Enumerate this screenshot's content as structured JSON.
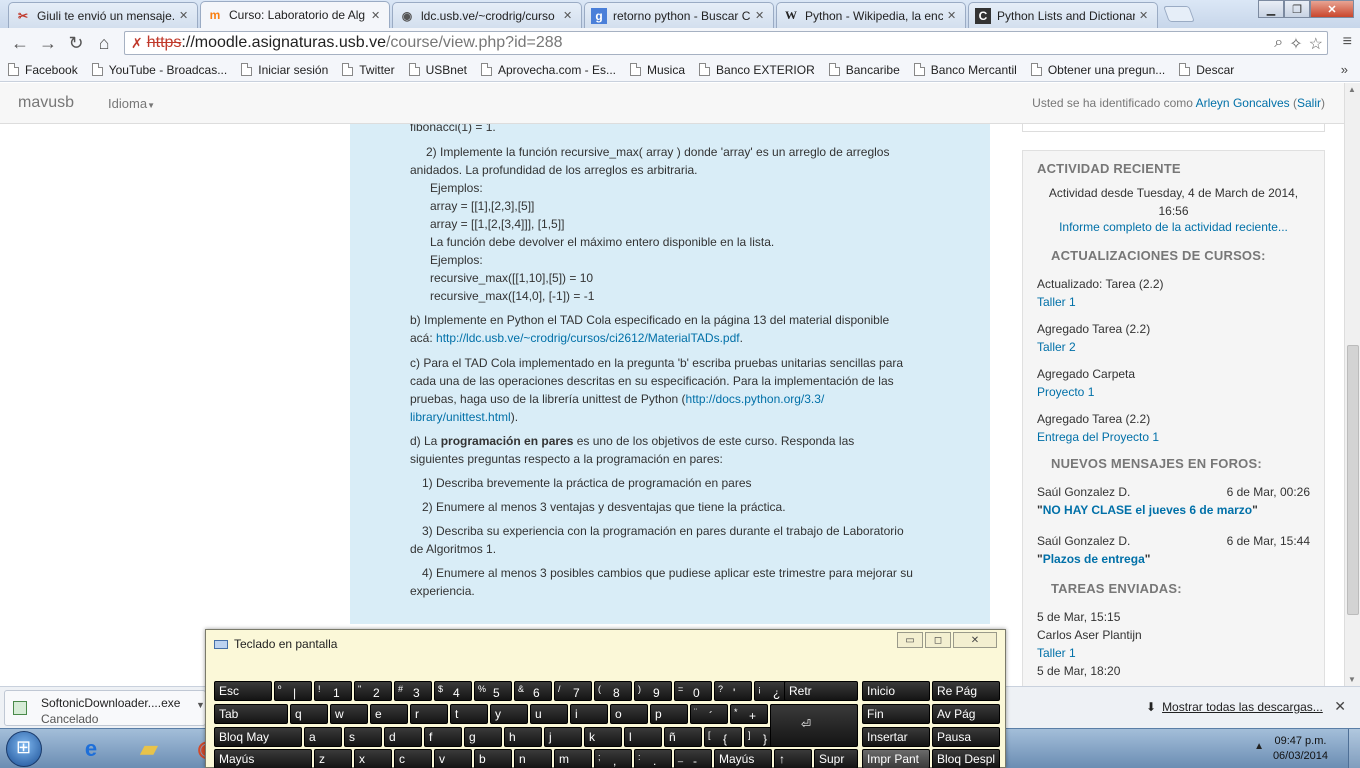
{
  "browser": {
    "tabs": [
      {
        "label": "Giuli te envió un mensaje.",
        "icon": "✂"
      },
      {
        "label": "Curso: Laboratorio de Alg",
        "icon": "m"
      },
      {
        "label": "ldc.usb.ve/~crodrig/curso",
        "icon": "◉"
      },
      {
        "label": "retorno python - Buscar C",
        "icon": "g"
      },
      {
        "label": "Python - Wikipedia, la enc",
        "icon": "W"
      },
      {
        "label": "Python Lists and Dictionar",
        "icon": "C"
      }
    ],
    "url": {
      "scheme": "https",
      "host": "://moodle.asignaturas.usb.ve",
      "path": "/course/view.php?id=288"
    },
    "bookmarks": [
      "Facebook",
      "YouTube - Broadcas...",
      "Iniciar sesión",
      "Twitter",
      "USBnet",
      "Aprovecha.com - Es...",
      "Musica",
      "Banco EXTERIOR",
      "Bancaribe",
      "Banco Mercantil",
      "Obtener una pregun...",
      "Descar"
    ],
    "bookmarks_more": "»"
  },
  "moodle": {
    "brand": "mavusb",
    "language": "Idioma",
    "login_prefix": "Usted se ha identificado como ",
    "user_name": "Arleyn Goncalves",
    "logout_open": " (",
    "logout": "Salir",
    "logout_close": ")"
  },
  "content": {
    "fib_tail": "fibonacci(1) = 1.",
    "q2_intro": "2) Implemente la función recursive_max( array ) donde 'array' es un arreglo de arreglos",
    "q2_intro2": "anidados. La profundidad de los arreglos es arbitraria.",
    "ex_label": "Ejemplos:",
    "ex1": "array = [[1],[2,3],[5]]",
    "ex2": "array = [[1,[2,[3,4]]], [1,5]]",
    "ret_desc": "La función debe devolver el máximo entero disponible en la lista.",
    "ex_label2": "Ejemplos:",
    "ex3": "recursive_max([[1,10],[5]) = 10",
    "ex4": "recursive_max([14,0], [-1]) = -1",
    "b_text": "b) Implemente en Python el TAD Cola especificado en la página 13 del material disponible",
    "b_text2": "acá: ",
    "b_link": "http://ldc.usb.ve/~crodrig/cursos/ci2612/MaterialTADs.pdf",
    "b_end": ".",
    "c_text1": "c) Para el TAD Cola implementado en la pregunta 'b' escriba pruebas unitarias sencillas para",
    "c_text2": "cada una de las operaciones descritas en su especificación. Para la implementación de las",
    "c_text3": "pruebas, haga uso de la librería unittest de Python (",
    "c_link1": "http://docs.python.org/3.3/",
    "c_link2": "library/unittest.html",
    "c_end": ").",
    "d_pre": "d) La ",
    "d_bold": "programación en pares",
    "d_post": " es uno de los objetivos de este curso. Responda las",
    "d_text2": "siguientes preguntas respecto a la programación en pares:",
    "d1": "1) Describa brevemente la práctica de programación en pares",
    "d2": "2) Enumere al menos 3 ventajas y desventajas que tiene la práctica.",
    "d3a": "3) Describa su experiencia con la programación en pares durante el trabajo de Laboratorio",
    "d3b": "de Algoritmos 1.",
    "d4a": "4) Enumere al menos 3 posibles cambios que pudiese aplicar este trimestre para mejorar su",
    "d4b": "experiencia."
  },
  "sidebar": {
    "title": "ACTIVIDAD RECIENTE",
    "since_line1": "Actividad desde Tuesday, 4 de March de 2014,",
    "since_line2": "16:56",
    "full_report": "Informe completo de la actividad reciente...",
    "updates_title": "ACTUALIZACIONES DE CURSOS:",
    "updates": [
      {
        "action": "Actualizado: Tarea (2.2)",
        "link": "Taller 1"
      },
      {
        "action": "Agregado Tarea (2.2)",
        "link": "Taller 2"
      },
      {
        "action": "Agregado Carpeta",
        "link": "Proyecto 1"
      },
      {
        "action": "Agregado Tarea (2.2)",
        "link": "Entrega del Proyecto 1"
      }
    ],
    "forum_title": "NUEVOS MENSAJES EN FOROS:",
    "forum": [
      {
        "author": "Saúl Gonzalez D.",
        "date": "6 de Mar, 00:26",
        "subject": "NO HAY CLASE el jueves 6 de marzo",
        "q1": "\"",
        "q2": "\""
      },
      {
        "author": "Saúl Gonzalez D.",
        "date": "6 de Mar, 15:44",
        "subject": "Plazos de entrega",
        "q1": "\"",
        "q2": "\""
      }
    ],
    "tasks_title": "TAREAS ENVIADAS:",
    "tasks": [
      {
        "date": "5 de Mar, 15:15",
        "author": "Carlos Aser Plantijn",
        "link": "Taller 1"
      },
      {
        "date": "5 de Mar, 18:20"
      }
    ]
  },
  "osk": {
    "title": "Teclado en pantalla",
    "minimize": "▭",
    "restore": "◻",
    "close": "✕",
    "row1": [
      {
        "m": "Esc"
      },
      {
        "s": "º",
        "m": "|"
      },
      {
        "s": "!",
        "m": "1"
      },
      {
        "s": "\"",
        "m": "2"
      },
      {
        "s": "#",
        "m": "3"
      },
      {
        "s": "$",
        "m": "4"
      },
      {
        "s": "%",
        "m": "5"
      },
      {
        "s": "&",
        "m": "6"
      },
      {
        "s": "/",
        "m": "7"
      },
      {
        "s": "(",
        "m": "8"
      },
      {
        "s": ")",
        "m": "9"
      },
      {
        "s": "=",
        "m": "0"
      },
      {
        "s": "?",
        "m": "'"
      },
      {
        "s": "¡",
        "m": "¿"
      },
      {
        "m": "Retr"
      },
      {
        "m": "Inicio"
      },
      {
        "m": "Re Pág"
      }
    ],
    "row2": [
      {
        "m": "Tab"
      },
      {
        "m": "q"
      },
      {
        "m": "w"
      },
      {
        "m": "e"
      },
      {
        "m": "r"
      },
      {
        "m": "t"
      },
      {
        "m": "y"
      },
      {
        "m": "u"
      },
      {
        "m": "i"
      },
      {
        "m": "o"
      },
      {
        "m": "p"
      },
      {
        "s": "¨",
        "m": "´"
      },
      {
        "s": "*",
        "m": "+"
      },
      {
        "m": "⏎"
      },
      {
        "m": "Fin"
      },
      {
        "m": "Av Pág"
      }
    ],
    "row3": [
      {
        "m": "Bloq May"
      },
      {
        "m": "a"
      },
      {
        "m": "s"
      },
      {
        "m": "d"
      },
      {
        "m": "f"
      },
      {
        "m": "g"
      },
      {
        "m": "h"
      },
      {
        "m": "j"
      },
      {
        "m": "k"
      },
      {
        "m": "l"
      },
      {
        "m": "ñ"
      },
      {
        "s": "[",
        "m": "{"
      },
      {
        "s": "]",
        "m": "}"
      },
      {
        "m": "Insertar"
      },
      {
        "m": "Pausa"
      }
    ],
    "row4": [
      {
        "m": "Mayús"
      },
      {
        "m": "z"
      },
      {
        "m": "x"
      },
      {
        "m": "c"
      },
      {
        "m": "v"
      },
      {
        "m": "b"
      },
      {
        "m": "n"
      },
      {
        "m": "m"
      },
      {
        "s": ";",
        "m": ","
      },
      {
        "s": ":",
        "m": "."
      },
      {
        "s": "_",
        "m": "-"
      },
      {
        "m": "Mayús"
      },
      {
        "m": "↑"
      },
      {
        "m": "Supr"
      },
      {
        "m": "Impr Pant"
      },
      {
        "m": "Bloq Despl"
      }
    ]
  },
  "downloads": {
    "file": "SoftonicDownloader....exe",
    "status": "Cancelado",
    "show_all": "Mostrar todas las descargas...",
    "close": "✕"
  },
  "taskbar": {
    "time": "09:47 p.m.",
    "date": "06/03/2014",
    "tray_arrow": "▲"
  }
}
